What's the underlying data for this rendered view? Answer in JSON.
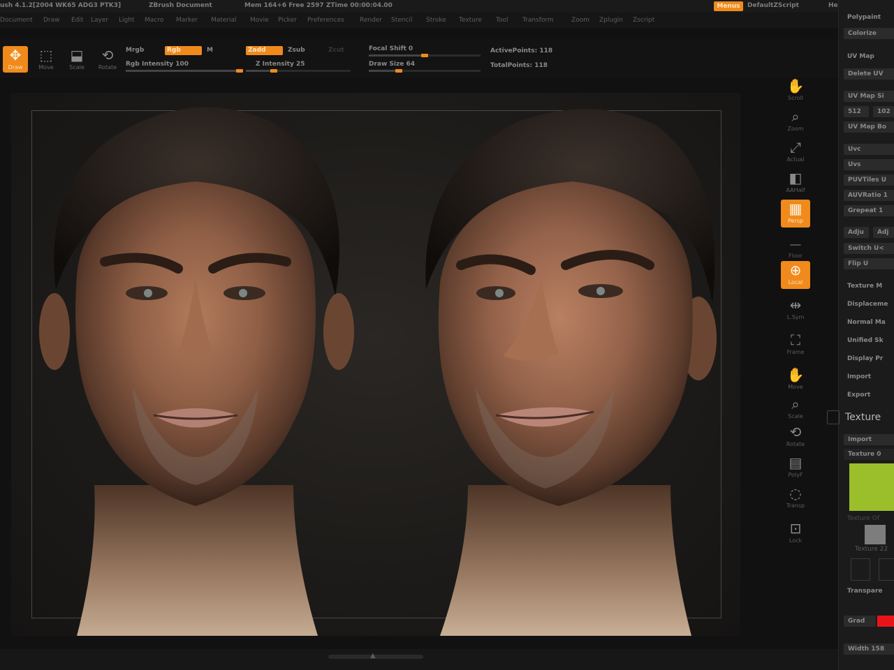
{
  "titlebar": {
    "app": "ush 4.1.2[2004 WK65 ADG3 PTK3]",
    "document": "ZBrush Document",
    "stats": "Mem 164+6  Free 2597  ZTime 00:00:04.00",
    "menus_button": "Menus",
    "script": "DefaultZScript",
    "help": "Help"
  },
  "menubar": {
    "items": [
      "Document",
      "Draw",
      "Edit",
      "Layer",
      "Light",
      "Macro",
      "Marker",
      "Material",
      "Movie",
      "Picker",
      "Preferences",
      "Render",
      "Stencil",
      "Stroke",
      "Texture",
      "Tool",
      "Transform",
      "Zoom",
      "Zplugin",
      "Zscript"
    ]
  },
  "toolbar": {
    "tools": [
      {
        "label": "Draw",
        "icon": "draw-icon",
        "active": true
      },
      {
        "label": "Move",
        "icon": "move-icon",
        "active": false
      },
      {
        "label": "Scale",
        "icon": "scale-icon",
        "active": false
      },
      {
        "label": "Rotate",
        "icon": "rotate-icon",
        "active": false
      }
    ],
    "mrgb": "Mrgb",
    "rgb": "Rgb",
    "m": "M",
    "rgb_intensity": "Rgb Intensity 100",
    "rgb_intensity_value": 100,
    "zadd": "Zadd",
    "zsub": "Zsub",
    "zcut": "Zcut",
    "z_intensity": "Z Intensity 25",
    "z_intensity_value": 25,
    "focal_shift": "Focal Shift 0",
    "focal_shift_value": 0,
    "draw_size": "Draw Size 64",
    "draw_size_value": 64,
    "active_points": "ActivePoints: 118",
    "total_points": "TotalPoints: 118"
  },
  "shelf": {
    "buttons": [
      {
        "label": "Scroll",
        "icon": "scroll-icon",
        "active": false
      },
      {
        "label": "Zoom",
        "icon": "zoom-icon",
        "active": false
      },
      {
        "label": "Actual",
        "icon": "actual-icon",
        "active": false
      },
      {
        "label": "AAHalf",
        "icon": "aahalf-icon",
        "active": false
      },
      {
        "label": "Persp",
        "icon": "persp-icon",
        "active": true
      },
      {
        "label": "Floor",
        "icon": "floor-icon",
        "active": false
      },
      {
        "label": "Local",
        "icon": "local-icon",
        "active": true
      },
      {
        "label": "L.Sym",
        "icon": "lsym-icon",
        "active": false
      },
      {
        "label": "Frame",
        "icon": "frame-icon",
        "active": false
      },
      {
        "label": "Move",
        "icon": "move-icon",
        "active": false
      },
      {
        "label": "Scale",
        "icon": "scale-icon",
        "active": false
      },
      {
        "label": "Rotate",
        "icon": "rotate-icon",
        "active": false
      },
      {
        "label": "PolyF",
        "icon": "polyf-icon",
        "active": false
      },
      {
        "label": "Transp",
        "icon": "transp-icon",
        "active": false
      },
      {
        "label": "Lock",
        "icon": "lock-icon",
        "active": false
      }
    ]
  },
  "tray": {
    "polypaint": "Polypaint",
    "colorize": "Colorize",
    "uv_map": "UV Map",
    "delete_uv": "Delete UV",
    "uv_map_size": "UV Map Si",
    "size_512": "512",
    "size_1024": "102",
    "uv_map_border": "UV Map Bo",
    "uvc": "Uvc",
    "uvs": "Uvs",
    "puvtiles": "PUVTiles U",
    "auvratio": "AUVRatio 1",
    "grepeat": "Grepeat 1",
    "adjust": "Adju",
    "adjust2": "Adj",
    "switch": "Switch U<",
    "flip": "Flip U",
    "texture_map": "Texture M",
    "displacement": "Displaceme",
    "normal_map": "Normal Ma",
    "unified_skin": "Unified Sk",
    "display_props": "Display Pr",
    "import": "Import",
    "export": "Export",
    "texture_header": "Texture",
    "tex_import": "Import",
    "texture_0": "Texture 0",
    "texture_off": "Texture Of",
    "texture_22": "Texture 22",
    "transparent": "Transpare",
    "grad": "Grad",
    "width": "Width 158"
  },
  "colors": {
    "accent": "#f08a1c",
    "background": "#111111",
    "texture_swatch": "#9bbf2a",
    "red_swatch": "#e8141a"
  }
}
